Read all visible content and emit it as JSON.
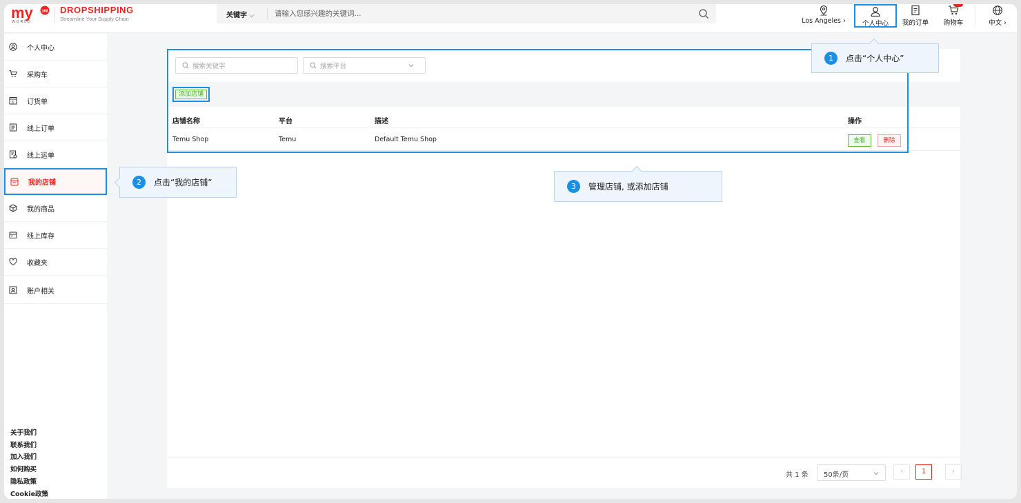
{
  "header": {
    "brand_title": "DROPSHIPPING",
    "brand_subtitle": "Streamline Your Supply Chain",
    "search_scope": "关键字",
    "search_placeholder": "请输入您感兴趣的关键词...",
    "location": "Los Angeles",
    "personal_center": "个人中心",
    "my_orders": "我的订单",
    "cart": "购物车",
    "language": "中文",
    "brand_color": "#e8261f"
  },
  "sidebar": {
    "items": [
      {
        "label": "个人中心",
        "icon": "user-circle-icon"
      },
      {
        "label": "采购车",
        "icon": "cart-icon"
      },
      {
        "label": "订货单",
        "icon": "order-form-icon"
      },
      {
        "label": "线上订单",
        "icon": "document-icon"
      },
      {
        "label": "线上运单",
        "icon": "waybill-icon"
      },
      {
        "label": "我的店铺",
        "icon": "store-icon"
      },
      {
        "label": "我的商品",
        "icon": "box-icon"
      },
      {
        "label": "线上库存",
        "icon": "inventory-icon"
      },
      {
        "label": "收藏夹",
        "icon": "heart-icon"
      },
      {
        "label": "账户相关",
        "icon": "account-icon"
      }
    ],
    "footer": [
      "关于我们",
      "联系我们",
      "加入我们",
      "如何购买",
      "隐私政策",
      "Cookie政策"
    ]
  },
  "main": {
    "filter_keyword_placeholder": "搜索关键字",
    "filter_platform_placeholder": "搜索平台",
    "add_store_label": "添加店铺",
    "columns": [
      "店铺名称",
      "平台",
      "描述",
      "操作"
    ],
    "rows": [
      {
        "name": "Temu Shop",
        "platform": "Temu",
        "description": "Default Temu Shop",
        "view_label": "查看",
        "delete_label": "删除"
      }
    ],
    "pagination": {
      "total": "共 1 条",
      "page_size": "50条/页",
      "current_page": "1",
      "prev": "‹",
      "next": "›"
    }
  },
  "tooltips": [
    {
      "num": "1",
      "text": "点击“个人中心”"
    },
    {
      "num": "2",
      "text": "点击“我的店铺”"
    },
    {
      "num": "3",
      "text": "管理店铺, 或添加店铺"
    }
  ]
}
